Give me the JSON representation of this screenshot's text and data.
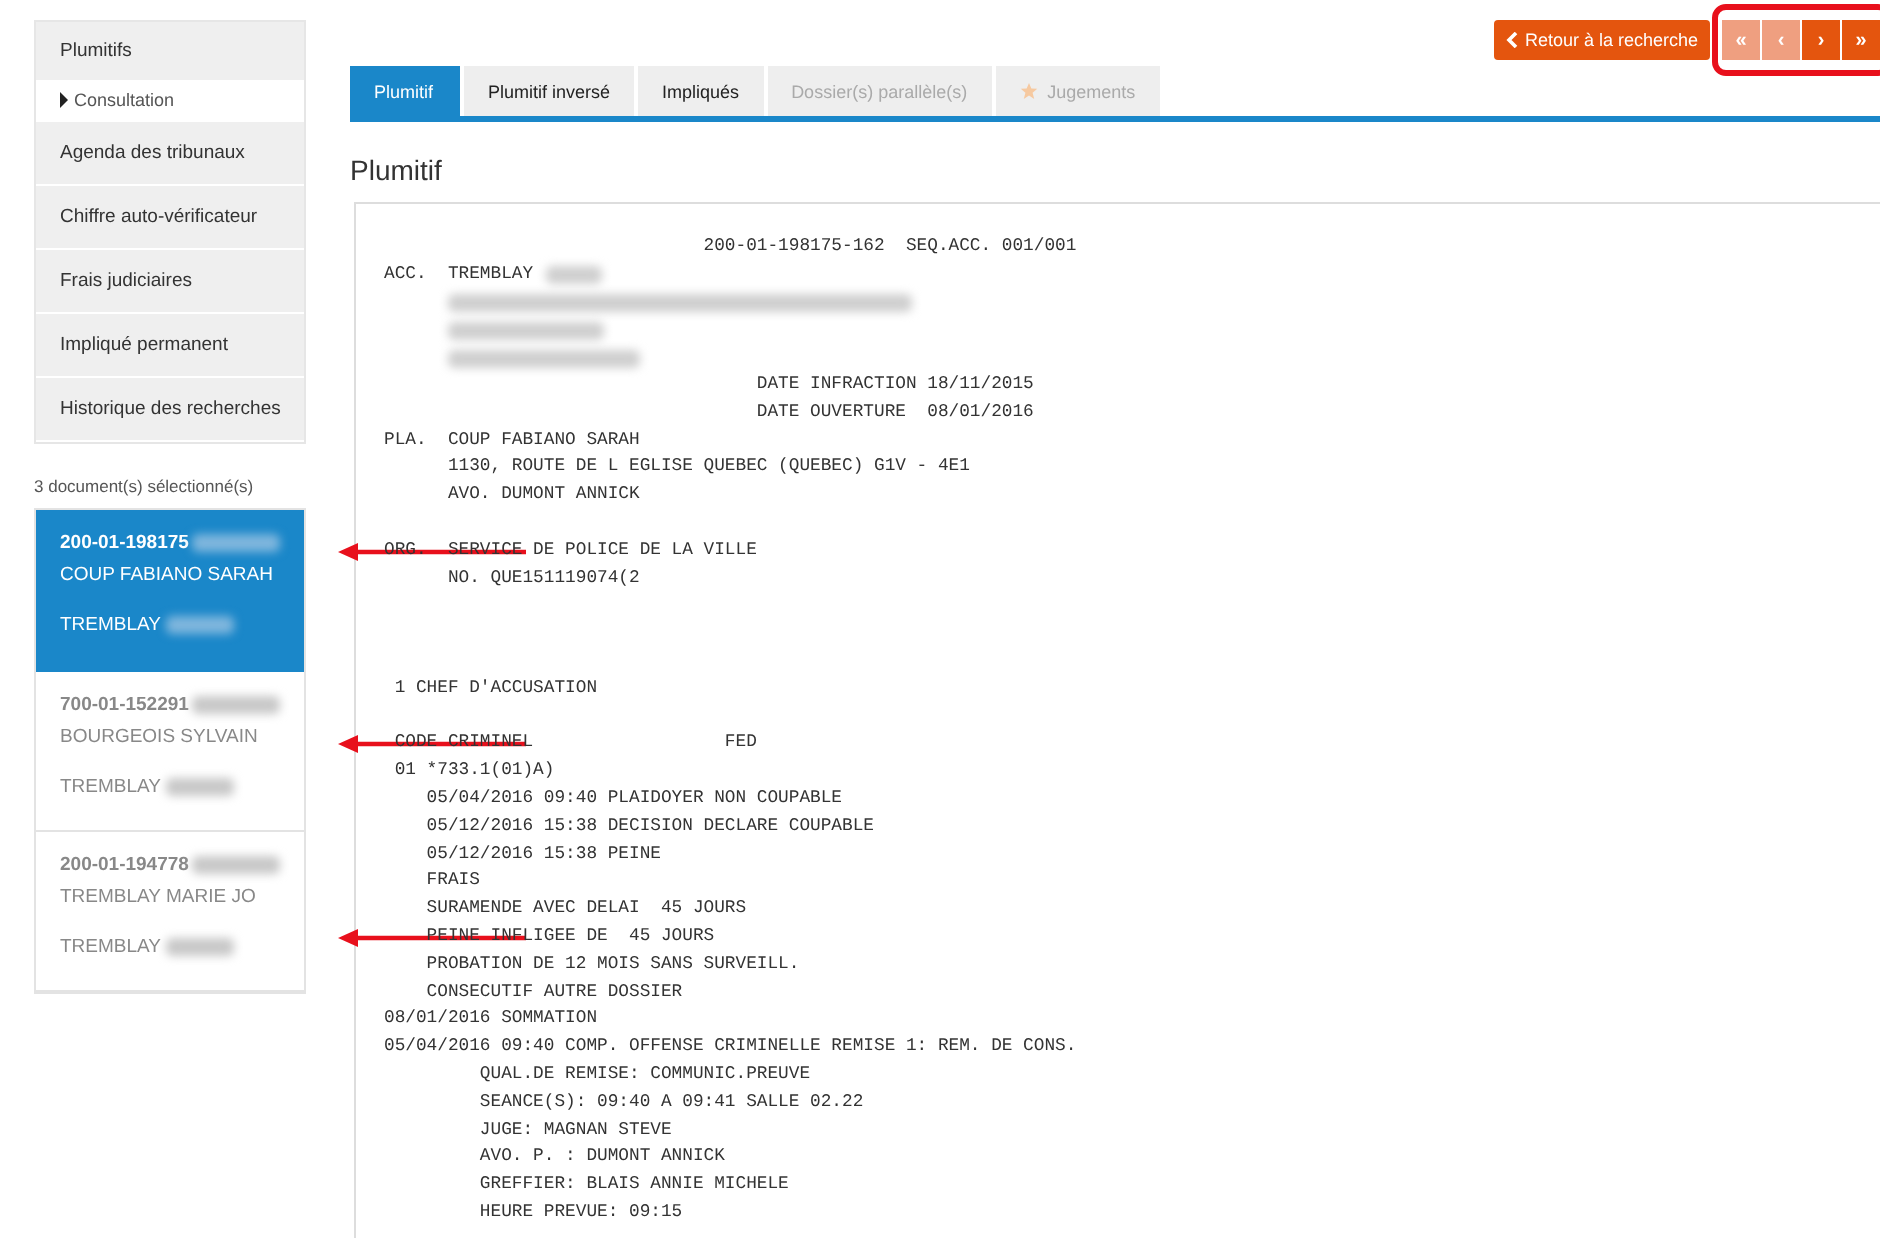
{
  "sidebar": {
    "menu": [
      {
        "label": "Plumitifs",
        "kind": "section",
        "selected": false
      },
      {
        "label": "Consultation",
        "kind": "subitem",
        "selected": true
      },
      {
        "label": "Agenda des tribunaux",
        "kind": "section",
        "selected": false
      },
      {
        "label": "Chiffre auto-vérificateur",
        "kind": "section",
        "selected": false
      },
      {
        "label": "Frais judiciaires",
        "kind": "section",
        "selected": false
      },
      {
        "label": "Impliqué permanent",
        "kind": "section",
        "selected": false
      },
      {
        "label": "Historique des recherches",
        "kind": "section",
        "selected": false
      }
    ],
    "selection_count": "3 document(s) sélectionné(s)",
    "documents": [
      {
        "number": "200-01-198175",
        "plaintiff": "COUP FABIANO SARAH",
        "accused": "TREMBLAY",
        "selected": true
      },
      {
        "number": "700-01-152291",
        "plaintiff": "BOURGEOIS SYLVAIN",
        "accused": "TREMBLAY",
        "selected": false
      },
      {
        "number": "200-01-194778",
        "plaintiff": "TREMBLAY MARIE JO",
        "accused": "TREMBLAY",
        "selected": false
      }
    ]
  },
  "toolbar": {
    "back_button": "Retour à la recherche",
    "pager": {
      "highlighted": true,
      "buttons": [
        {
          "label": "«",
          "disabled": true
        },
        {
          "label": "‹",
          "disabled": true
        },
        {
          "label": "›",
          "disabled": false
        },
        {
          "label": "»",
          "disabled": false
        }
      ]
    }
  },
  "tabs": [
    {
      "label": "Plumitif",
      "selected": true,
      "disabled": false,
      "starred": false
    },
    {
      "label": "Plumitif inversé",
      "selected": false,
      "disabled": false,
      "starred": false
    },
    {
      "label": "Impliqués",
      "selected": false,
      "disabled": false,
      "starred": false
    },
    {
      "label": "Dossier(s) parallèle(s)",
      "selected": false,
      "disabled": true,
      "starred": false
    },
    {
      "label": "Jugements",
      "selected": false,
      "disabled": true,
      "starred": true
    }
  ],
  "heading": "Plumitif",
  "record": {
    "lines": [
      {
        "kind": "text",
        "text": "                              200-01-198175-162  SEQ.ACC. 001/001",
        "marked": false
      },
      {
        "kind": "text",
        "text": "ACC.  TREMBLAY",
        "redacted_after": true,
        "marked": false
      },
      {
        "kind": "redacted",
        "marked": false
      },
      {
        "kind": "redacted",
        "marked": false
      },
      {
        "kind": "redacted",
        "marked": false
      },
      {
        "kind": "text",
        "text": "                                   DATE INFRACTION 18/11/2015",
        "marked": false
      },
      {
        "kind": "text",
        "text": "                                   DATE OUVERTURE  08/01/2016",
        "marked": false
      },
      {
        "kind": "text",
        "text": "PLA.  COUP FABIANO SARAH",
        "marked": false
      },
      {
        "kind": "text",
        "text": "      1130, ROUTE DE L EGLISE QUEBEC (QUEBEC) G1V - 4E1",
        "marked": false
      },
      {
        "kind": "text",
        "text": "      AVO. DUMONT ANNICK",
        "marked": false
      },
      {
        "kind": "blank",
        "marked": false
      },
      {
        "kind": "text",
        "text": "ORG.  SERVICE DE POLICE DE LA VILLE",
        "marked": true
      },
      {
        "kind": "text",
        "text": "      NO. QUE151119074(2",
        "marked": false
      },
      {
        "kind": "blank",
        "marked": false
      },
      {
        "kind": "blank",
        "marked": false
      },
      {
        "kind": "blank",
        "marked": false
      },
      {
        "kind": "text",
        "text": " 1 CHEF D'ACCUSATION",
        "marked": false
      },
      {
        "kind": "blank",
        "marked": false
      },
      {
        "kind": "text",
        "text": " CODE CRIMINEL                  FED",
        "marked": true
      },
      {
        "kind": "text",
        "text": " 01 *733.1(01)A)",
        "marked": false
      },
      {
        "kind": "text",
        "text": "    05/04/2016 09:40 PLAIDOYER NON COUPABLE",
        "marked": false
      },
      {
        "kind": "text",
        "text": "    05/12/2016 15:38 DECISION DECLARE COUPABLE",
        "marked": false
      },
      {
        "kind": "text",
        "text": "    05/12/2016 15:38 PEINE",
        "marked": false
      },
      {
        "kind": "text",
        "text": "    FRAIS",
        "marked": false
      },
      {
        "kind": "text",
        "text": "    SURAMENDE AVEC DELAI  45 JOURS",
        "marked": false
      },
      {
        "kind": "text",
        "text": "    PEINE INFLIGEE DE  45 JOURS",
        "marked": true
      },
      {
        "kind": "text",
        "text": "    PROBATION DE 12 MOIS SANS SURVEILL.",
        "marked": false
      },
      {
        "kind": "text",
        "text": "    CONSECUTIF AUTRE DOSSIER",
        "marked": false
      },
      {
        "kind": "text",
        "text": "08/01/2016 SOMMATION",
        "marked": false
      },
      {
        "kind": "text",
        "text": "05/04/2016 09:40 COMP. OFFENSE CRIMINELLE REMISE 1: REM. DE CONS.",
        "marked": false
      },
      {
        "kind": "text",
        "text": "         QUAL.DE REMISE: COMMUNIC.PREUVE",
        "marked": false
      },
      {
        "kind": "text",
        "text": "         SEANCE(S): 09:40 A 09:41 SALLE 02.22",
        "marked": false
      },
      {
        "kind": "text",
        "text": "         JUGE: MAGNAN STEVE",
        "marked": false
      },
      {
        "kind": "text",
        "text": "         AVO. P. : DUMONT ANNICK",
        "marked": false
      },
      {
        "kind": "text",
        "text": "         GREFFIER: BLAIS ANNIE MICHELE",
        "marked": false
      },
      {
        "kind": "text",
        "text": "         HEURE PREVUE: 09:15",
        "marked": false
      }
    ]
  }
}
